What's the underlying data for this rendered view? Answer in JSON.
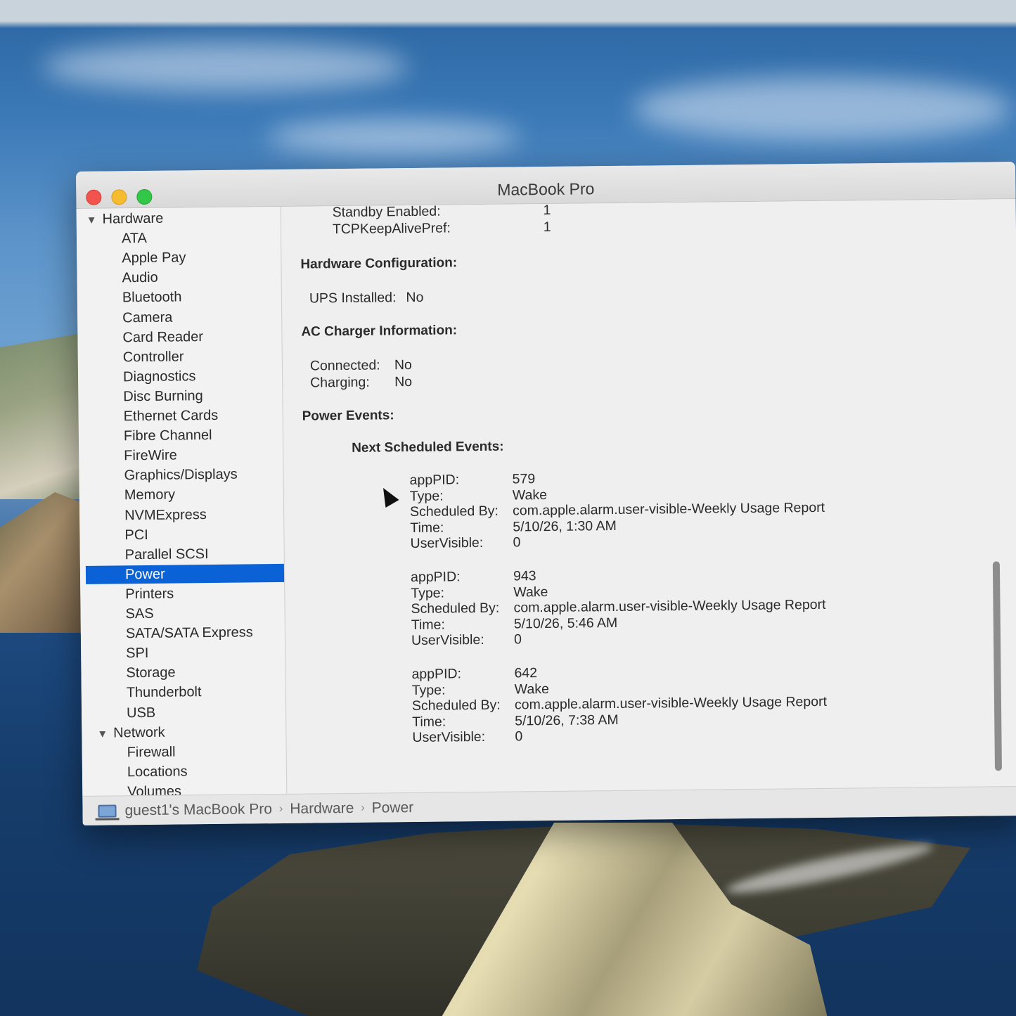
{
  "window": {
    "title": "MacBook Pro"
  },
  "sidebar": {
    "groups": [
      {
        "label": "Hardware",
        "expanded": true
      },
      {
        "label": "Network",
        "expanded": true
      }
    ],
    "hardware_items": [
      "ATA",
      "Apple Pay",
      "Audio",
      "Bluetooth",
      "Camera",
      "Card Reader",
      "Controller",
      "Diagnostics",
      "Disc Burning",
      "Ethernet Cards",
      "Fibre Channel",
      "FireWire",
      "Graphics/Displays",
      "Memory",
      "NVMExpress",
      "PCI",
      "Parallel SCSI",
      "Power",
      "Printers",
      "SAS",
      "SATA/SATA Express",
      "SPI",
      "Storage",
      "Thunderbolt",
      "USB"
    ],
    "network_items": [
      "Firewall",
      "Locations",
      "Volumes"
    ],
    "selected": "Power"
  },
  "content": {
    "top_settings": [
      {
        "label": "Standby Enabled:",
        "value": "1"
      },
      {
        "label": "TCPKeepAlivePref:",
        "value": "1"
      }
    ],
    "hardware_config": {
      "heading": "Hardware Configuration:",
      "ups_label": "UPS Installed:",
      "ups_value": "No"
    },
    "ac_charger": {
      "heading": "AC Charger Information:",
      "connected_label": "Connected:",
      "connected_value": "No",
      "charging_label": "Charging:",
      "charging_value": "No"
    },
    "power_events": {
      "heading": "Power Events:",
      "subheading": "Next Scheduled Events:",
      "labels": {
        "app_pid": "appPID:",
        "type": "Type:",
        "scheduled_by": "Scheduled By:",
        "time": "Time:",
        "user_visible": "UserVisible:"
      },
      "events": [
        {
          "app_pid": "579",
          "type": "Wake",
          "scheduled_by": "com.apple.alarm.user-visible-Weekly Usage Report",
          "time": "5/10/26, 1:30 AM",
          "user_visible": "0"
        },
        {
          "app_pid": "943",
          "type": "Wake",
          "scheduled_by": "com.apple.alarm.user-visible-Weekly Usage Report",
          "time": "5/10/26, 5:46 AM",
          "user_visible": "0"
        },
        {
          "app_pid": "642",
          "type": "Wake",
          "scheduled_by": "com.apple.alarm.user-visible-Weekly Usage Report",
          "time": "5/10/26, 7:38 AM",
          "user_visible": "0"
        }
      ]
    }
  },
  "pathbar": {
    "crumbs": [
      "guest1's MacBook Pro",
      "Hardware",
      "Power"
    ],
    "separator": "›"
  },
  "colors": {
    "selection": "#0b62d6",
    "close": "#f2544d",
    "minimize": "#f6bc2f",
    "maximize": "#33c748"
  }
}
